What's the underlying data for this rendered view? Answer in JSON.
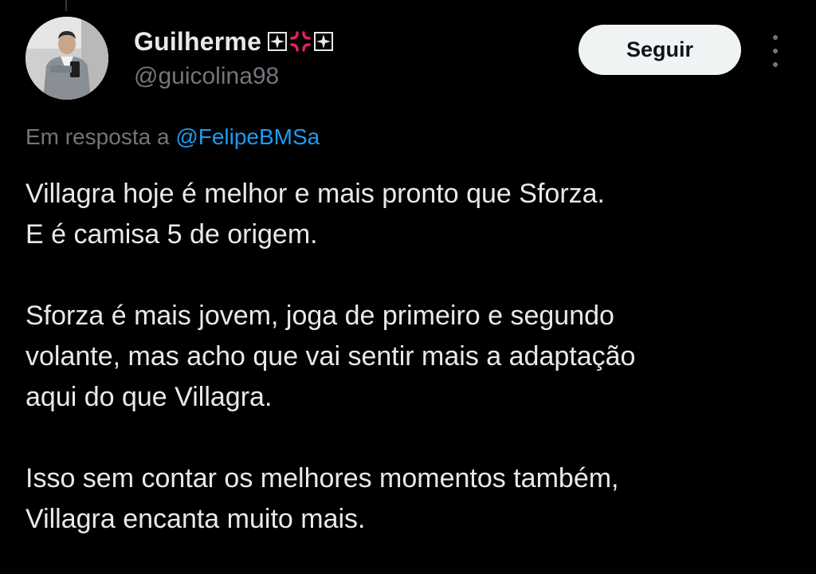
{
  "author": {
    "display_name": "Guilherme",
    "handle": "@guicolina98",
    "name_emojis": [
      "cross-pattee-icon",
      "anger-symbol-icon",
      "cross-pattee-icon"
    ]
  },
  "actions": {
    "follow_label": "Seguir",
    "more_icon": "more-vertical-icon"
  },
  "reply": {
    "prefix": "Em resposta a",
    "mention": "@FelipeBMSa"
  },
  "tweet": {
    "lines": [
      "Villagra hoje é melhor e mais pronto que Sforza.",
      "E é camisa 5 de origem.",
      "Sforza é mais jovem, joga de primeiro e segundo",
      "volante, mas acho que vai sentir mais a adaptação",
      "aqui do que Villagra.",
      "Isso sem contar os melhores momentos também,",
      "Villagra encanta muito mais."
    ]
  },
  "colors": {
    "background": "#000000",
    "text": "#e7e9ea",
    "muted": "#71767b",
    "link": "#1d9bf0",
    "button_bg": "#eff3f4",
    "anger_red": "#e0245e"
  }
}
